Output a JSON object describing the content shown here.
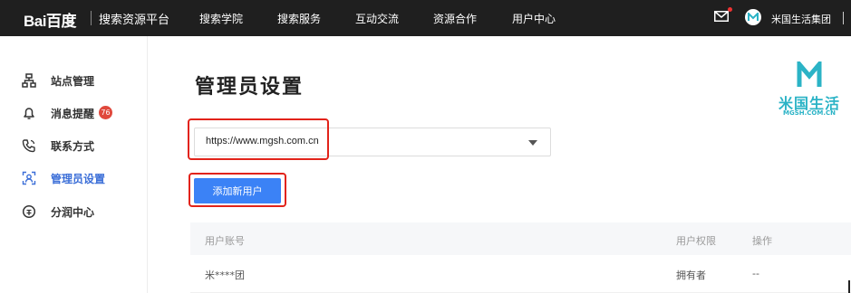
{
  "header": {
    "logo_text": "Bai百度",
    "platform": "搜索资源平台",
    "nav": [
      "搜索学院",
      "搜索服务",
      "互动交流",
      "资源合作",
      "用户中心"
    ],
    "username": "米国生活集团"
  },
  "sidebar": {
    "items": [
      {
        "label": "站点管理",
        "icon": "sitemap-icon"
      },
      {
        "label": "消息提醒",
        "icon": "bell-icon",
        "badge": "76"
      },
      {
        "label": "联系方式",
        "icon": "phone-icon"
      },
      {
        "label": "管理员设置",
        "icon": "admin-icon",
        "active": true
      },
      {
        "label": "分润中心",
        "icon": "coin-icon"
      }
    ]
  },
  "main": {
    "title": "管理员设置",
    "site_select_value": "https://www.mgsh.com.cn",
    "add_user_label": "添加新用户",
    "table": {
      "columns": [
        "用户账号",
        "用户权限",
        "操作"
      ],
      "rows": [
        {
          "account": "米****团",
          "permission": "拥有者",
          "action": "--"
        }
      ]
    }
  },
  "brand": {
    "name": "米国生活",
    "url": "MGSH.COM.CN",
    "color": "#2bb3c6"
  },
  "colors": {
    "accent": "#3b82f6",
    "active": "#3c6fd8",
    "highlight": "#e2231a",
    "badge": "#e0483c"
  }
}
